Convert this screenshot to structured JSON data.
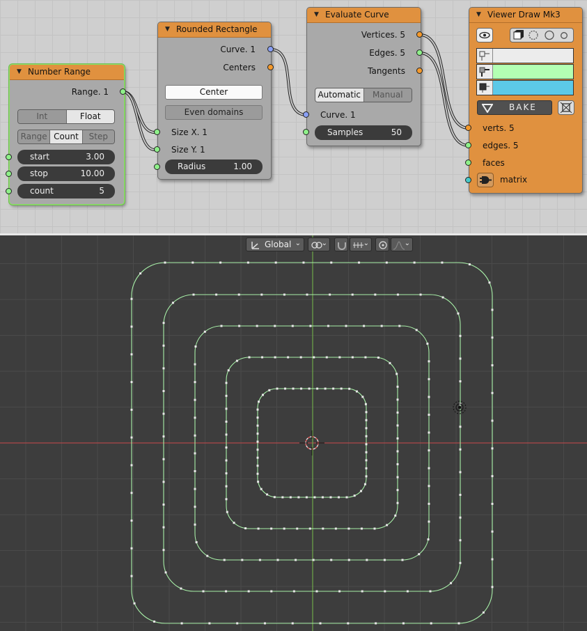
{
  "node_editor": {
    "nodes": {
      "number_range": {
        "title": "Number Range",
        "output_label": "Range. 1",
        "mode_options": [
          "Int",
          "Float"
        ],
        "mode_selected": "Float",
        "range_options": [
          "Range",
          "Count",
          "Step"
        ],
        "range_selected": "Count",
        "fields": [
          {
            "label": "start",
            "value": "3.00"
          },
          {
            "label": "stop",
            "value": "10.00"
          },
          {
            "label": "count",
            "value": "5"
          }
        ]
      },
      "rounded_rectangle": {
        "title": "Rounded Rectangle",
        "outputs": [
          "Curve. 1",
          "Centers"
        ],
        "center_button": "Center",
        "even_domains_button": "Even domains",
        "inputs": [
          "Size X. 1",
          "Size Y. 1"
        ],
        "radius": {
          "label": "Radius",
          "value": "1.00"
        }
      },
      "evaluate_curve": {
        "title": "Evaluate Curve",
        "outputs": [
          "Vertices. 5",
          "Edges. 5",
          "Tangents"
        ],
        "mode_options": [
          "Automatic",
          "Manual"
        ],
        "mode_selected": "Automatic",
        "input": "Curve. 1",
        "samples": {
          "label": "Samples",
          "value": "50"
        }
      },
      "viewer_draw": {
        "title": "Viewer Draw Mk3",
        "bake_label": "BAKE",
        "colors": {
          "vertex": "#ececec",
          "edge": "#b3ffb3",
          "face": "#5cc9e8"
        },
        "inputs": [
          "verts. 5",
          "edges. 5",
          "faces",
          "matrix"
        ]
      }
    }
  },
  "viewport": {
    "orientation_label": "Global",
    "orientation_icon": "transform-orientation-icon",
    "pivot_icon": "pivot-point-icon",
    "snap_icon": "snap-magnet-icon",
    "snap_element_icon": "snap-increment-icon",
    "proportional_icon": "proportional-edit-icon",
    "falloff_icon": "falloff-curve-icon",
    "curve_color": "#a8f0a8"
  }
}
